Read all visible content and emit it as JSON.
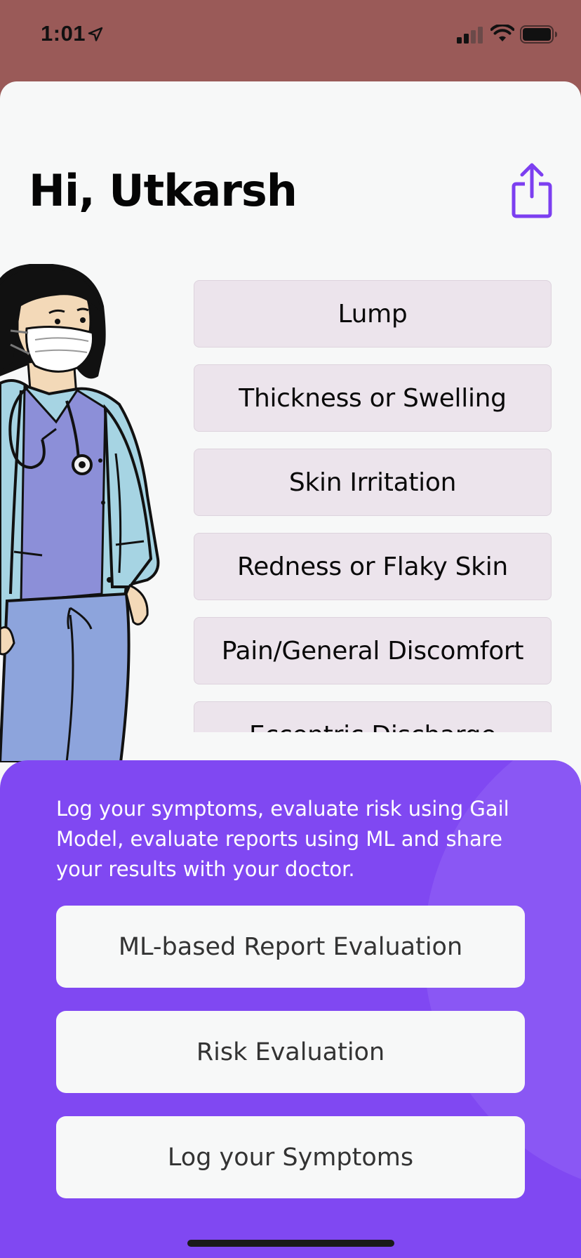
{
  "status_bar": {
    "time": "1:01",
    "location_icon": "location-arrow-icon",
    "signal_icon": "cellular-signal-icon",
    "wifi_icon": "wifi-icon",
    "battery_icon": "battery-icon"
  },
  "header": {
    "greeting": "Hi, Utkarsh",
    "share_icon": "share-icon"
  },
  "illustration": {
    "icon": "doctor-illustration"
  },
  "symptoms": [
    {
      "label": "Lump"
    },
    {
      "label": "Thickness or Swelling"
    },
    {
      "label": "Skin Irritation"
    },
    {
      "label": "Redness or Flaky Skin"
    },
    {
      "label": "Pain/General Discomfort"
    },
    {
      "label": "Eccentric Discharge"
    }
  ],
  "panel": {
    "description": "Log your symptoms, evaluate risk using Gail Model, evaluate reports using ML and share your results with your doctor.",
    "buttons": [
      {
        "label": "ML-based Report Evaluation"
      },
      {
        "label": "Risk Evaluation"
      },
      {
        "label": "Log your Symptoms"
      }
    ]
  },
  "colors": {
    "status_bar_bg": "#9a5a58",
    "card_bg": "#f7f8f8",
    "accent": "#8048f2",
    "symptom_bg": "#ece4ec"
  }
}
